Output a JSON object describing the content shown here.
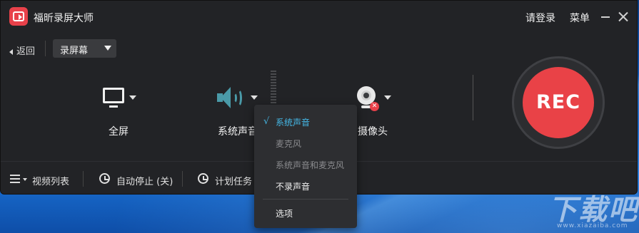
{
  "app": {
    "title": "福昕录屏大师",
    "login": "请登录",
    "menu": "菜单"
  },
  "toolbar": {
    "back": "返回",
    "mode": "录屏幕"
  },
  "options": {
    "screen": "全屏",
    "audio": "系统声音",
    "camera": "摄像头"
  },
  "rec": {
    "label": "REC",
    "color": "#e94247"
  },
  "bottom": {
    "video_list": "视频列表",
    "auto_stop": "自动停止 (关)",
    "schedule": "计划任务 ("
  },
  "audio_menu": {
    "check": "√",
    "items": [
      {
        "label": "系统声音",
        "state": "selected"
      },
      {
        "label": "麦克风",
        "state": "disabled"
      },
      {
        "label": "系统声音和麦克风",
        "state": "disabled"
      },
      {
        "label": "不录声音",
        "state": "normal"
      },
      {
        "label": "选项",
        "state": "normal"
      }
    ],
    "accent": "#45b8e6"
  },
  "watermark": {
    "brand": "下载吧",
    "url": "www.xiazaiba.com"
  }
}
